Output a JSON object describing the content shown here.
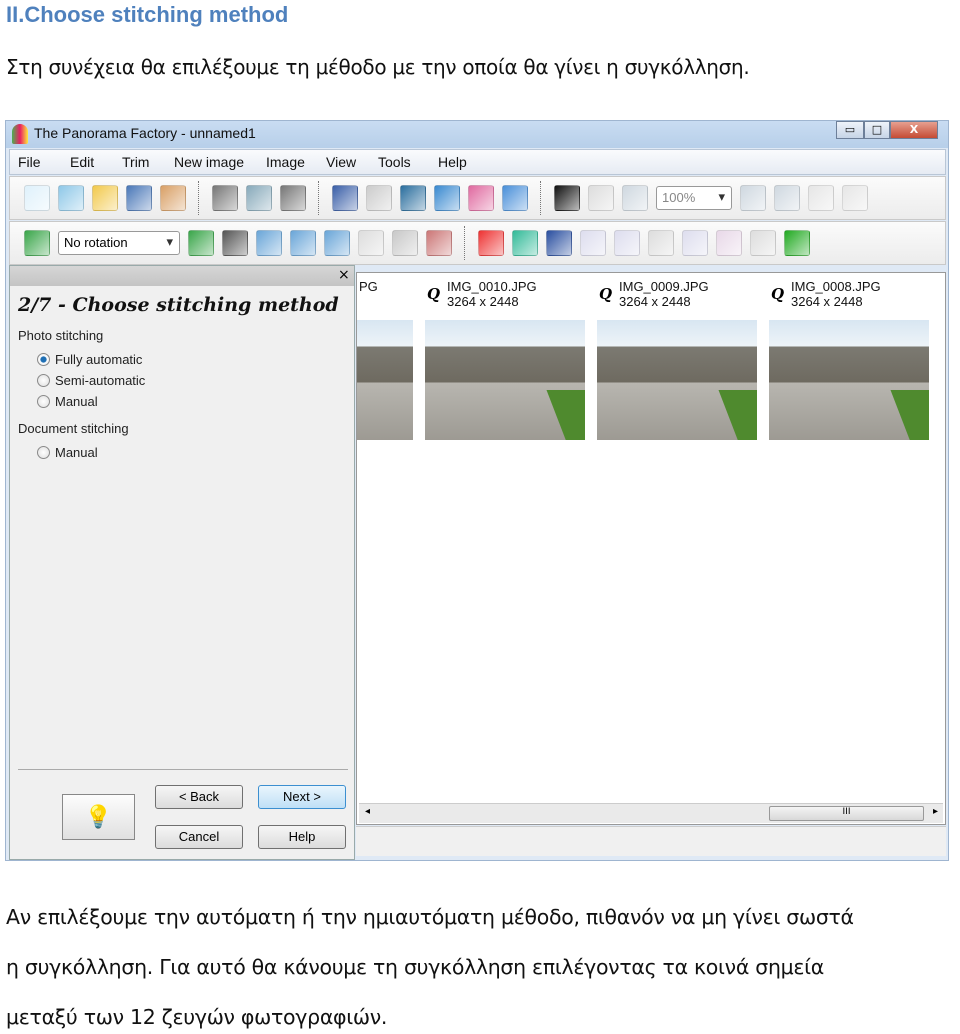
{
  "heading": "II.Choose stitching method",
  "intro": "Στη συνέχεια θα επιλέξουμε τη μέθοδο με την οποία θα γίνει η συγκόλληση.",
  "window": {
    "title": "The Panorama Factory - unnamed1",
    "controls": {
      "minimize": "▭",
      "maximize": "□",
      "close": "X"
    },
    "menu": [
      "File",
      "Edit",
      "Trim",
      "New image",
      "Image",
      "View",
      "Tools",
      "Help"
    ],
    "toolbar1": {
      "icons": [
        [
          "new-file-icon",
          "#dff1fb"
        ],
        [
          "wizard-icon",
          "#8fc8e8"
        ],
        [
          "open-folder-icon",
          "#f2c94c"
        ],
        [
          "save-icon",
          "#4a78b8"
        ],
        [
          "package-icon",
          "#d9a066"
        ],
        [
          "sep",
          ""
        ],
        [
          "scan-icon",
          "#777"
        ],
        [
          "print-preview-icon",
          "#8ab"
        ],
        [
          "print-icon",
          "#777"
        ],
        [
          "sep",
          ""
        ],
        [
          "cut-icon",
          "#3a5fa8"
        ],
        [
          "copy-icon",
          "#ccc"
        ],
        [
          "paste-icon",
          "#2a6e9e"
        ],
        [
          "book-icon",
          "#3a8ad0"
        ],
        [
          "panorama-logo-icon",
          "#e06aa0"
        ],
        [
          "help-pointer-icon",
          "#4a90d9"
        ]
      ],
      "icons2": [
        [
          "pointer-icon",
          "#111"
        ],
        [
          "hand-icon",
          "#ddd"
        ],
        [
          "zoom-icon",
          "#cfd8e0"
        ]
      ],
      "zoom_value": "100%",
      "icons3": [
        [
          "zoom-in-icon",
          "#cfd8e0"
        ],
        [
          "zoom-out-icon",
          "#cfd8e0"
        ],
        [
          "actual-size-icon",
          "#e6e6e6"
        ],
        [
          "move-icon",
          "#e6e6e6"
        ]
      ]
    },
    "toolbar2": {
      "icons_a": [
        [
          "import-icon",
          "#3aa64a"
        ]
      ],
      "rotation_value": "No rotation",
      "icons_b": [
        [
          "export-icon",
          "#3aa64a"
        ],
        [
          "filmstrip-icon",
          "#555"
        ],
        [
          "rotate-left-icon",
          "#6aa6d8"
        ],
        [
          "rotate-right-icon",
          "#6aa6d8"
        ],
        [
          "rotate-icon",
          "#6aa6d8"
        ],
        [
          "back-arrow-icon",
          "#ddd"
        ],
        [
          "crop-icon",
          "#c8c8c8"
        ],
        [
          "crop-cut-icon",
          "#c77"
        ],
        [
          "sep",
          ""
        ],
        [
          "color-triangle-icon",
          "#e33"
        ],
        [
          "color-zoom-icon",
          "#3b9"
        ],
        [
          "stretch-cut-icon",
          "#2a4fa0"
        ],
        [
          "align-icon",
          "#dde"
        ],
        [
          "vertical-adjust-icon",
          "#dde"
        ],
        [
          "horizontal-adjust-icon",
          "#ddd"
        ],
        [
          "grid-adjust-icon",
          "#dde"
        ],
        [
          "color-wheel-icon",
          "#e8d8e8"
        ],
        [
          "face-icon",
          "#ddd"
        ],
        [
          "histogram-icon",
          "#2a2"
        ]
      ]
    },
    "wizard": {
      "close": "×",
      "step": "2/7 - Choose stitching method",
      "photo_group": "Photo stitching",
      "photo_options": [
        {
          "label": "Fully automatic",
          "selected": true
        },
        {
          "label": "Semi-automatic",
          "selected": false
        },
        {
          "label": "Manual",
          "selected": false
        }
      ],
      "document_group": "Document stitching",
      "document_options": [
        {
          "label": "Manual",
          "selected": false
        }
      ],
      "buttons": {
        "back": "< Back",
        "next": "Next >",
        "cancel": "Cancel",
        "help": "Help"
      }
    },
    "thumbnails": [
      {
        "name": "PG",
        "size": ""
      },
      {
        "name": "IMG_0010.JPG",
        "size": "3264 x 2448"
      },
      {
        "name": "IMG_0009.JPG",
        "size": "3264 x 2448"
      },
      {
        "name": "IMG_0008.JPG",
        "size": "3264 x 2448"
      }
    ],
    "scroll_grip": "III"
  },
  "body": [
    "Αν επιλέξουμε την αυτόματη ή την ημιαυτόματη μέθοδο, πιθανόν να μη γίνει σωστά",
    "η συγκόλληση. Για αυτό θα κάνουμε τη συγκόλληση επιλέγοντας τα κοινά σημεία",
    "μεταξύ των 12 ζευγών φωτογραφιών."
  ]
}
